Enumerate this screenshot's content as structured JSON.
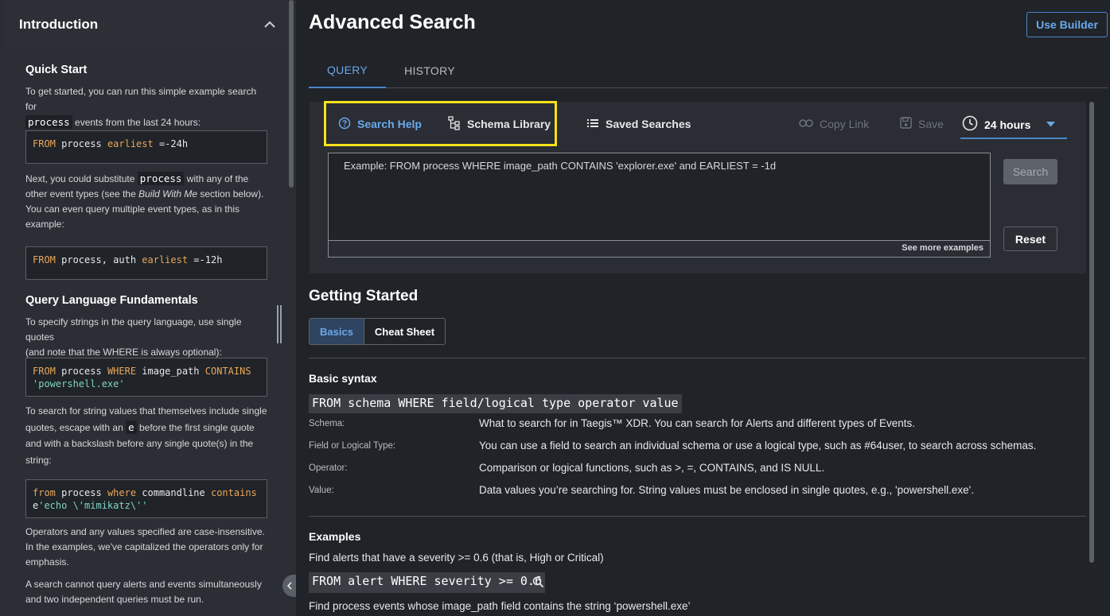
{
  "sidebar": {
    "title": "Introduction",
    "quick_start": {
      "heading": "Quick Start",
      "p1_a": "To get started, you can run this simple example search for",
      "p1_code": "process",
      "p1_b": "events from the last 24 hours:",
      "code1": {
        "kw1": "FROM",
        "t1": " process ",
        "kw2": "earliest",
        "t2": " =-24h"
      },
      "p2_a": "Next, you could substitute",
      "p2_code": "process",
      "p2_b": "with any of the",
      "p2_c": "other event types (see the",
      "p2_italic": "Build With Me",
      "p2_d": "section below).",
      "p2_e": "You can even query multiple event types, as in this",
      "p2_f": "example:",
      "code2": {
        "kw1": "FROM",
        "t1": " process, auth ",
        "kw2": "earliest",
        "t2": " =-12h"
      }
    },
    "fundamentals": {
      "heading": "Query Language Fundamentals",
      "p1_a": "To specify strings in the query language, use single quotes",
      "p1_b": "(and note that the WHERE is always optional):",
      "code3": {
        "kw1": "FROM",
        "t1": " process ",
        "kw2": "WHERE",
        "t2": " image_path ",
        "kw3": "CONTAINS",
        "str": "'powershell.exe'"
      },
      "p2_a": "To search for string values that themselves include single",
      "p2_b": "quotes, escape with an",
      "p2_code": "e",
      "p2_c": "before the first single quote",
      "p2_d": "and with a backslash before any single quote(s) in the",
      "p2_e": "string:",
      "code4": {
        "kw1": "from",
        "t1": " process ",
        "kw2": "where",
        "t2": " commandline ",
        "kw3": "contains",
        "t3": "e",
        "str": "'echo \\'mimikatz\\''"
      },
      "p3_a": "Operators and any values specified are case-insensitive.",
      "p3_b": "In the examples, we've capitalized the operators only for",
      "p3_c": "emphasis.",
      "p4_a": "A search cannot query alerts and events simultaneously",
      "p4_b": "and two independent queries must be run."
    }
  },
  "header": {
    "title": "Advanced Search",
    "use_builder": "Use Builder"
  },
  "tabs": [
    {
      "label": "QUERY"
    },
    {
      "label": "HISTORY"
    }
  ],
  "toolbar": {
    "search_help": "Search Help",
    "schema_library": "Schema Library",
    "saved_searches": "Saved Searches",
    "copy_link": "Copy Link",
    "save": "Save",
    "time_range": "24 hours"
  },
  "query": {
    "placeholder": "Example: FROM process WHERE image_path CONTAINS 'explorer.exe' and EARLIEST = -1d",
    "see_more": "See more examples",
    "search": "Search",
    "reset": "Reset"
  },
  "getting_started": {
    "title": "Getting Started",
    "segments": [
      {
        "label": "Basics"
      },
      {
        "label": "Cheat Sheet"
      }
    ],
    "basic_syntax_title": "Basic syntax",
    "basic_syntax_code": "FROM schema WHERE field/logical type operator value",
    "definitions": [
      {
        "label": "Schema:",
        "value": "What to search for in Taegis™ XDR. You can search for Alerts and different types of Events."
      },
      {
        "label": "Field or Logical Type:",
        "value": "You can use a field to search an individual schema or use a logical type, such as #64user, to search across schemas."
      },
      {
        "label": "Operator:",
        "value": "Comparison or logical functions, such as >, =, CONTAINS, and IS NULL."
      },
      {
        "label": "Value:",
        "value": "Data values you’re searching for. String values must be enclosed in single quotes, e.g., 'powershell.exe'."
      }
    ],
    "examples_title": "Examples",
    "examples": [
      {
        "desc": "Find alerts that have a severity >= 0.6 (that is, High or Critical)",
        "code": "FROM alert WHERE severity >= 0.6"
      },
      {
        "desc": "Find process events whose image_path field contains the string ‘powershell.exe’"
      }
    ]
  },
  "colors": {
    "accent": "#6aa9ec",
    "highlight": "#f5e11a",
    "keyword": "#e8a75a",
    "string": "#7fd3c3"
  }
}
